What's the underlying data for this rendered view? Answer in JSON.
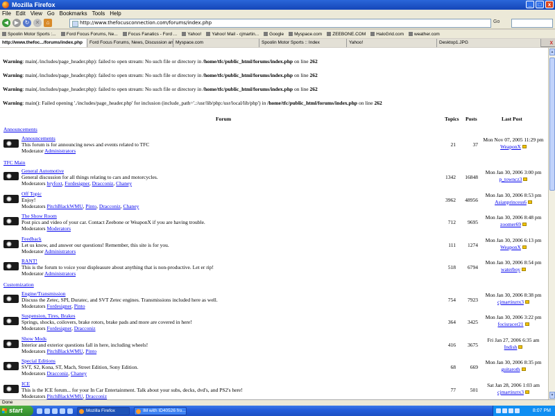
{
  "window": {
    "title": "Mozilla Firefox",
    "buttons": {
      "minimize": "_",
      "maximize": "□",
      "close": "x"
    }
  },
  "menu": [
    "File",
    "Edit",
    "View",
    "Go",
    "Bookmarks",
    "Tools",
    "Help"
  ],
  "nav": {
    "url": "http://www.thefocusconnection.com/forums/index.php",
    "go_label": "Go",
    "back_glyph": "◀",
    "forward_glyph": "▶",
    "reload_glyph": "↻",
    "stop_glyph": "✕",
    "home_glyph": "⌂"
  },
  "bookmarks": [
    "Spoolin Motor Sports :...",
    "Ford Focus Forums, Ne...",
    "Focus Fanatics - Ford ...",
    "Yahoo!",
    "Yahoo! Mail - cjmartin...",
    "Google",
    "Myspace.com",
    "ZEEBONE.COM",
    "HaloGrid.com",
    "weather.com"
  ],
  "tabs": [
    {
      "label": "http://www.thefoc.../forums/index.php",
      "active": true
    },
    {
      "label": "Ford Focus Forums, News, Discussion and Chat",
      "active": false
    },
    {
      "label": "Myspace.com",
      "active": false
    },
    {
      "label": "Spoolin Motor Sports :: Index",
      "active": false
    },
    {
      "label": "Yahoo!",
      "active": false
    },
    {
      "label": "Desktop1.JPG",
      "active": false
    }
  ],
  "tab_close": "x",
  "warnings": [
    {
      "prefix": "Warning",
      "text": ": main(./includes/page_header.php): failed to open stream: No such file or directory in ",
      "path": "/home/tfc/public_html/forums/index.php",
      "suffix": " on line ",
      "line": "262"
    },
    {
      "prefix": "Warning",
      "text": ": main(./includes/page_header.php): failed to open stream: No such file or directory in ",
      "path": "/home/tfc/public_html/forums/index.php",
      "suffix": " on line ",
      "line": "262"
    },
    {
      "prefix": "Warning",
      "text": ": main(./includes/page_header.php): failed to open stream: No such file or directory in ",
      "path": "/home/tfc/public_html/forums/index.php",
      "suffix": " on line ",
      "line": "262"
    },
    {
      "prefix": "Warning",
      "text": ": main(): Failed opening './includes/page_header.php' for inclusion (include_path='.:/usr/lib/php:/usr/local/lib/php') in ",
      "path": "/home/tfc/public_html/forums/index.php",
      "suffix": " on line ",
      "line": "262"
    }
  ],
  "table_headers": {
    "forum": "Forum",
    "topics": "Topics",
    "posts": "Posts",
    "last_post": "Last Post"
  },
  "categories": {
    "announcements": "Announcements",
    "tfc_main": "TFC Main",
    "customization": "Customization"
  },
  "forums": [
    {
      "name": "Announcements",
      "desc": "This forum is for announcing news and events related to TFC",
      "mod_label": "Moderator",
      "mods": [
        "Administrators"
      ],
      "topics": "21",
      "posts": "37",
      "last_date": "Mon Nov 07, 2005 11:29 pm",
      "last_user": "WeaponX"
    },
    {
      "name": "General Automotive",
      "desc": "General discussion for all things relating to cars and motorcycles.",
      "mod_label": "Moderators",
      "mods": [
        "bryfoxt",
        "Fordesigner",
        "Dracconiz",
        "Chaney"
      ],
      "topics": "1342",
      "posts": "16848",
      "last_date": "Mon Jan 30, 2006 3:00 pm",
      "last_user": "p_towncz3"
    },
    {
      "name": "Off Topic",
      "desc": "Enjoy!",
      "mod_label": "Moderators",
      "mods": [
        "PitchBlackWMU",
        "Pinto",
        "Dracconiz",
        "Chaney"
      ],
      "topics": "3962",
      "posts": "48956",
      "last_date": "Mon Jan 30, 2006 8:53 pm",
      "last_user": "Asianprincess6"
    },
    {
      "name": "The Show Room",
      "desc": "Post pics and video of your car. Contact Zeebone or WeaponX if you are having trouble.",
      "mod_label": "Moderators",
      "mods": [
        "Moderators"
      ],
      "topics": "712",
      "posts": "9695",
      "last_date": "Mon Jan 30, 2006 8:48 pm",
      "last_user": "zoomer69"
    },
    {
      "name": "Feedback",
      "desc": "Let us know, and answer our questions! Remember, this site is for you.",
      "mod_label": "Moderator",
      "mods": [
        "Administrators"
      ],
      "topics": "111",
      "posts": "1274",
      "last_date": "Mon Jan 30, 2006 6:13 pm",
      "last_user": "WeaponX"
    },
    {
      "name": "RANT!",
      "desc": "This is the forum to voice your displeasure about anything that is non-productive. Let er rip!",
      "mod_label": "Moderator",
      "mods": [
        "Administrators"
      ],
      "topics": "518",
      "posts": "6794",
      "last_date": "Mon Jan 30, 2006 8:54 pm",
      "last_user": "waterboy"
    },
    {
      "name": "Engine/Transmission",
      "desc": "Discuss the Zetec, SPI, Duratec, and SVT Zetec engines. Transmissions included here as well.",
      "mod_label": "Moderators",
      "mods": [
        "Fordesigner",
        "Pinto"
      ],
      "topics": "754",
      "posts": "7923",
      "last_date": "Mon Jan 30, 2006 8:38 pm",
      "last_user": "cjmartinztx3"
    },
    {
      "name": "Suspension, Tires, Brakes",
      "desc": "Springs, shocks, coilovers, brake rotors, brake pads and more are covered in here!",
      "mod_label": "Moderators",
      "mods": [
        "Fordesigner",
        "Dracconiz"
      ],
      "topics": "364",
      "posts": "3425",
      "last_date": "Mon Jan 30, 2006 3:22 pm",
      "last_user": "focisracer21"
    },
    {
      "name": "Show Mods",
      "desc": "Interior and exterior questions fall in here, including wheels!",
      "mod_label": "Moderators",
      "mods": [
        "PitchBlackWMU",
        "Pinto"
      ],
      "topics": "416",
      "posts": "3675",
      "last_date": "Fri Jan 27, 2006 6:35 am",
      "last_user": "Indish"
    },
    {
      "name": "Special Editions",
      "desc": "SVT, S2, Kona, ST, Mach, Street Edition, Sony Edition.",
      "mod_label": "Moderators",
      "mods": [
        "Dracconiz",
        "Chaney"
      ],
      "topics": "68",
      "posts": "669",
      "last_date": "Mon Jan 30, 2006 8:35 pm",
      "last_user": "guitaroth"
    },
    {
      "name": "ICE",
      "desc": "This is the ICE forum... for your In Car Entertainment. Talk about your subs, decks, dvd's, and PS2's here!",
      "mod_label": "Moderators",
      "mods": [
        "PitchBlackWMU",
        "Dracconiz"
      ],
      "topics": "77",
      "posts": "501",
      "last_date": "Sat Jan 28, 2006 1:03 am",
      "last_user": "cjmartinztx3"
    }
  ],
  "status": "Done",
  "taskbar": {
    "start": "start",
    "items": [
      {
        "label": "Mozilla Firefox",
        "active": true
      },
      {
        "label": "IM with ID40526 fro...",
        "active": false
      }
    ],
    "clock": "8:07 PM"
  }
}
